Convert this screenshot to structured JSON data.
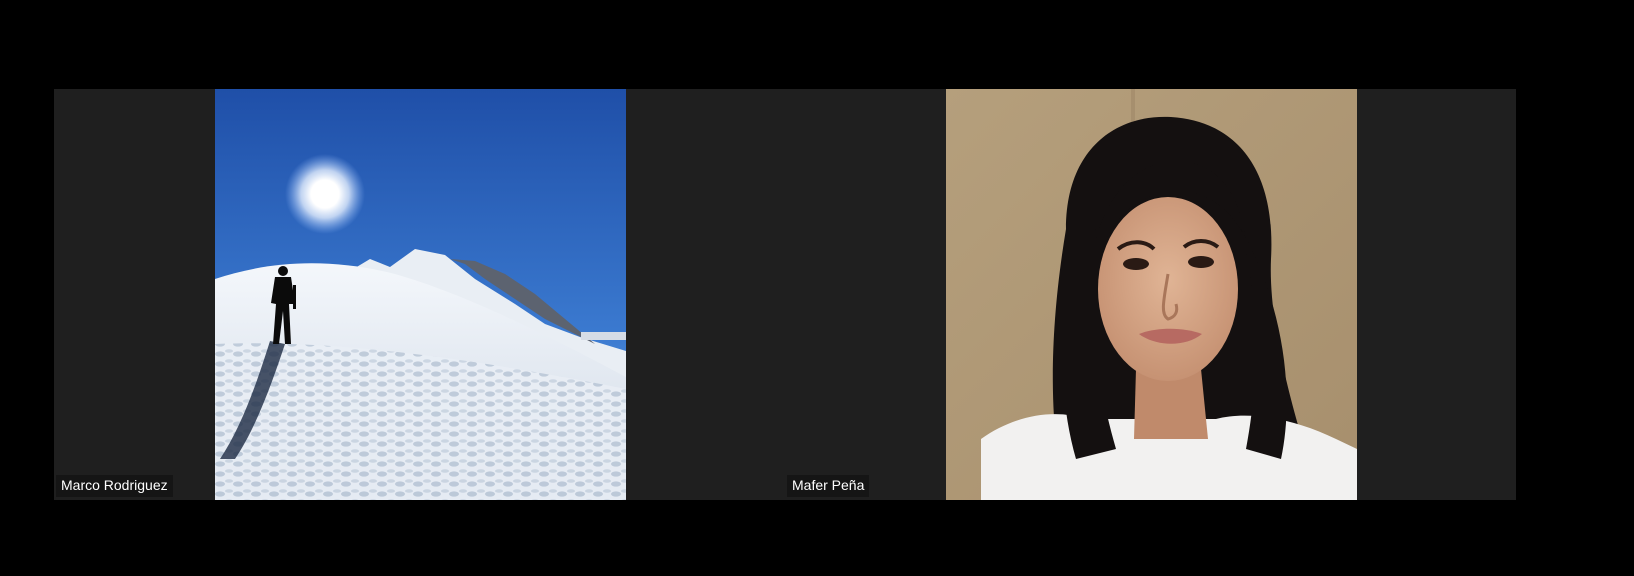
{
  "participants": [
    {
      "name": "Marco Rodriguez",
      "video": "mountain-snow-scene"
    },
    {
      "name": "Mafer Peña",
      "video": "person-portrait"
    }
  ],
  "colors": {
    "background": "#000000",
    "tile": "#1f1f1f",
    "name_tag_bg": "#141414",
    "name_tag_text": "#ffffff"
  }
}
